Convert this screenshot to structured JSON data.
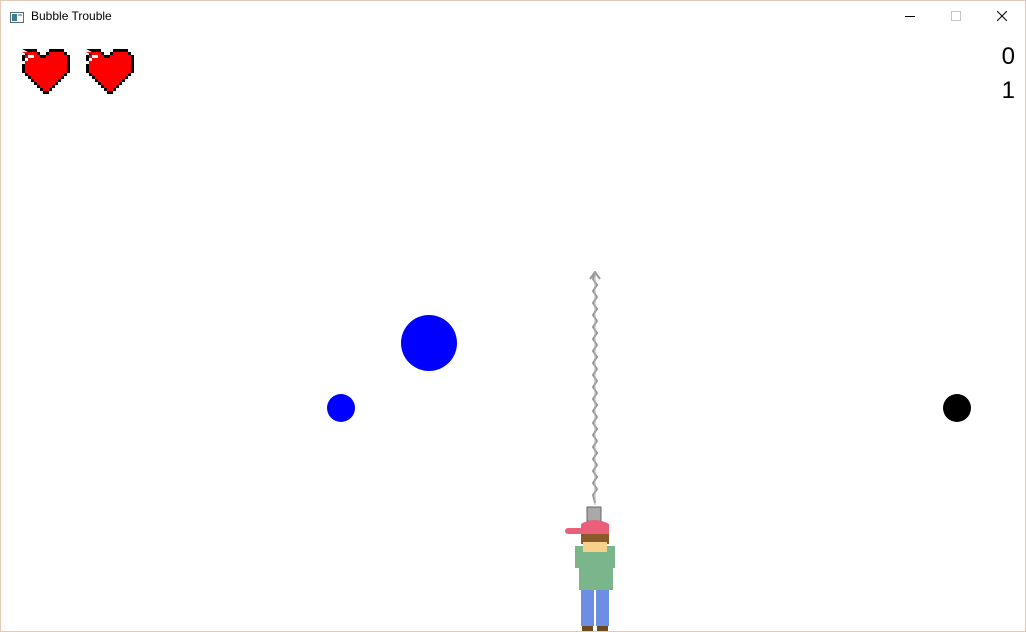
{
  "window": {
    "title": "Bubble Trouble",
    "app_icon": "window-app-icon",
    "controls": {
      "minimize": "minimize-icon",
      "maximize": "maximize-icon",
      "close": "close-icon"
    }
  },
  "hud": {
    "lives": 2,
    "life_icon": "heart-icon",
    "score_top": "0",
    "score_bottom": "1"
  },
  "colors": {
    "ball_blue": "#0000ff",
    "ball_black": "#000000",
    "heart_red": "#ff0000",
    "rope_gray": "#999999",
    "cap_pink": "#ea5f79",
    "shirt_green": "#7bb58b",
    "pants_blue": "#6e8ee6"
  }
}
